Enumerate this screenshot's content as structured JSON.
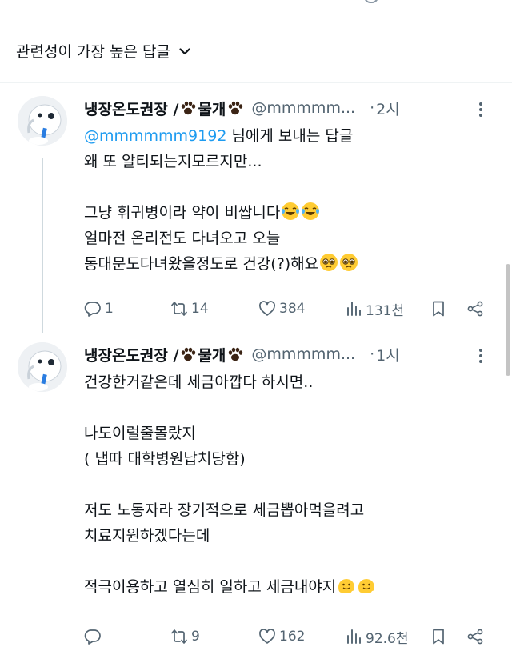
{
  "sort": {
    "label": "관련성이 가장 높은 답글"
  },
  "replies": [
    {
      "name_part1": "냉장온도권장 / ",
      "name_part2": "물개",
      "handle": "@mmmmm...",
      "time": "2시",
      "mention": "@mmmmmm9192",
      "mention_suffix": " 님에게 보내는 답글",
      "lines": [
        "왜 또 알티되는지모르지만...",
        "",
        "그냥 휘귀병이라 약이 비쌉니다",
        "얼마전 온리전도 다녀오고 오늘",
        "동대문도다녀왔을정도로 건강(?)해요"
      ],
      "emoji_line_3": "laughing-crying",
      "emoji_line_5": "pleading",
      "stats": {
        "replies": "1",
        "reposts": "14",
        "likes": "384",
        "views": "131천"
      }
    },
    {
      "name_part1": "냉장온도권장 / ",
      "name_part2": "물개",
      "handle": "@mmmmm...",
      "time": "1시",
      "lines": [
        "건강한거같은데 세금아깝다 하시면..",
        "",
        "나도이럴줄몰랐지",
        "( 냅따 대학병원납치당함)",
        "",
        " 저도 노동자라 장기적으로 세금뽑아먹을려고",
        "치료지원하겠다는데",
        "",
        "적극이용하고 열심히 일하고 세금내야지"
      ],
      "emoji_line_9": "melting",
      "stats": {
        "replies": "",
        "reposts": "9",
        "likes": "162",
        "views": "92.6천"
      }
    }
  ],
  "colors": {
    "text": "#0f1419",
    "secondary": "#536471",
    "link": "#1d9bf0",
    "divider": "#eff3f4"
  },
  "icons": [
    "chevron-down-icon",
    "paw-icon",
    "more-icon",
    "reply-icon",
    "repost-icon",
    "like-icon",
    "views-icon",
    "bookmark-icon",
    "share-icon"
  ]
}
